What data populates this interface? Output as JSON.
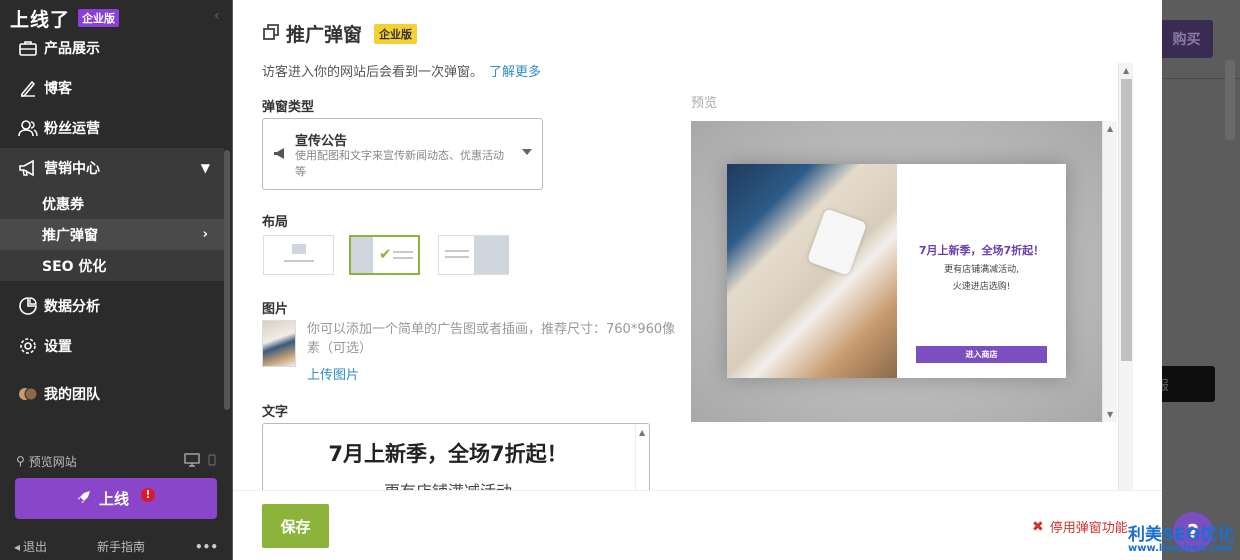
{
  "sidebar": {
    "brand": "上线了",
    "brand_badge": "企业版",
    "nav": [
      {
        "label": "产品展示"
      },
      {
        "label": "博客"
      },
      {
        "label": "粉丝运营"
      },
      {
        "label": "营销中心"
      }
    ],
    "sub_items": [
      {
        "label": "优惠券"
      },
      {
        "label": "推广弹窗"
      },
      {
        "label": "SEO 优化"
      }
    ],
    "nav2": [
      {
        "label": "数据分析"
      },
      {
        "label": "设置"
      },
      {
        "label": "我的团队"
      }
    ],
    "preview_site": "预览网站",
    "online_button": "上线",
    "logout": "退出",
    "guide": "新手指南"
  },
  "background": {
    "buy_button": "购买",
    "dark_button": "报"
  },
  "modal": {
    "title": "推广弹窗",
    "title_badge": "企业版",
    "description": "访客进入你的网站后会看到一次弹窗。",
    "learn_more": "了解更多",
    "type_label": "弹窗类型",
    "type_select": {
      "title": "宣传公告",
      "subtitle": "使用配图和文字来宣传新闻动态、优惠活动等"
    },
    "layout_label": "布局",
    "layout_selected": 2,
    "image_label": "图片",
    "image_hint": "你可以添加一个简单的广告图或者插画，推荐尺寸：760*960像素（可选）",
    "upload_link": "上传图片",
    "text_label": "文字",
    "text_heading": "7月上新季，全场7折起！",
    "text_body": "更有店铺满减活动",
    "preview_label": "预览",
    "popup": {
      "heading": "7月上新季，全场7折起！",
      "line1": "更有店铺满减活动,",
      "line2": "火速进店选购!",
      "button": "进入商店"
    },
    "save_button": "保存",
    "disable_link": "停用弹窗功能"
  },
  "help_button": "?",
  "watermark": {
    "line1": "利美SEO优化",
    "line2": "www.limeiseo.com"
  }
}
